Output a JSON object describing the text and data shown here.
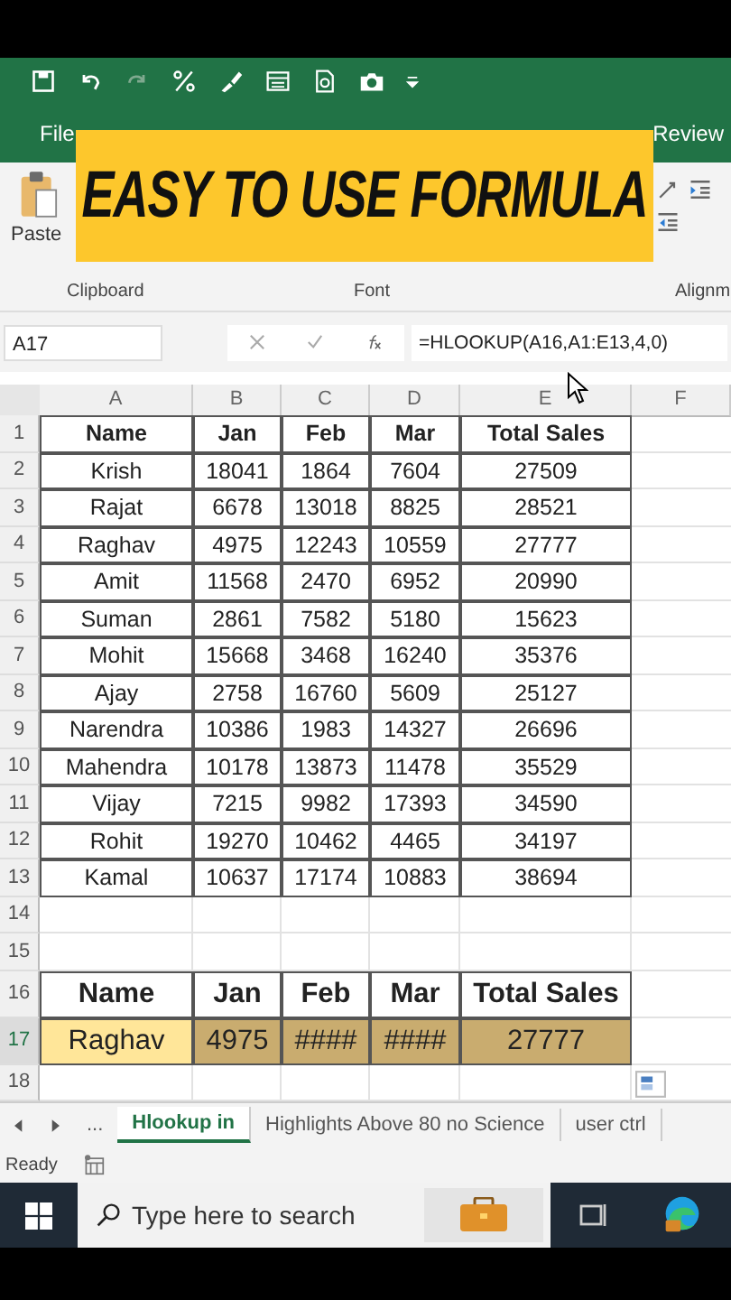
{
  "ribbon": {
    "tabs": [
      {
        "label": "File",
        "selected": false
      },
      {
        "label": "Review",
        "selected": false
      }
    ],
    "paste_label": "Paste",
    "groups": [
      "Clipboard",
      "Font",
      "Alignm"
    ]
  },
  "banner": {
    "text": "EASY TO USE FORMULA"
  },
  "formula_bar": {
    "name_box": "A17",
    "formula": "=HLOOKUP(A16,A1:E13,4,0)"
  },
  "sheet": {
    "column_headers": [
      "A",
      "B",
      "C",
      "D",
      "E",
      "F"
    ],
    "rows": [
      {
        "number": "1",
        "kind": "header",
        "cells": [
          "Name",
          "Jan",
          "Feb",
          "Mar",
          "Total Sales"
        ]
      },
      {
        "number": "2",
        "kind": "data",
        "cells": [
          "Krish",
          "18041",
          "1864",
          "7604",
          "27509"
        ]
      },
      {
        "number": "3",
        "kind": "data",
        "cells": [
          "Rajat",
          "6678",
          "13018",
          "8825",
          "28521"
        ]
      },
      {
        "number": "4",
        "kind": "data",
        "cells": [
          "Raghav",
          "4975",
          "12243",
          "10559",
          "27777"
        ]
      },
      {
        "number": "5",
        "kind": "data",
        "cells": [
          "Amit",
          "11568",
          "2470",
          "6952",
          "20990"
        ]
      },
      {
        "number": "6",
        "kind": "data",
        "cells": [
          "Suman",
          "2861",
          "7582",
          "5180",
          "15623"
        ]
      },
      {
        "number": "7",
        "kind": "data",
        "cells": [
          "Mohit",
          "15668",
          "3468",
          "16240",
          "35376"
        ]
      },
      {
        "number": "8",
        "kind": "data",
        "cells": [
          "Ajay",
          "2758",
          "16760",
          "5609",
          "25127"
        ]
      },
      {
        "number": "9",
        "kind": "data",
        "cells": [
          "Narendra",
          "10386",
          "1983",
          "14327",
          "26696"
        ]
      },
      {
        "number": "10",
        "kind": "data",
        "cells": [
          "Mahendra",
          "10178",
          "13873",
          "11478",
          "35529"
        ]
      },
      {
        "number": "11",
        "kind": "data",
        "cells": [
          "Vijay",
          "7215",
          "9982",
          "17393",
          "34590"
        ]
      },
      {
        "number": "12",
        "kind": "data",
        "cells": [
          "Rohit",
          "19270",
          "10462",
          "4465",
          "34197"
        ]
      },
      {
        "number": "13",
        "kind": "data",
        "cells": [
          "Kamal",
          "10637",
          "17174",
          "10883",
          "38694"
        ]
      },
      {
        "number": "14",
        "kind": "blank"
      },
      {
        "number": "15",
        "kind": "blank"
      },
      {
        "number": "16",
        "kind": "result_header",
        "cells": [
          "Name",
          "Jan",
          "Feb",
          "Mar",
          "Total Sales"
        ]
      },
      {
        "number": "17",
        "kind": "result",
        "cells": [
          {
            "text": "Raghav",
            "active": true
          },
          {
            "text": "4975",
            "active": false
          },
          {
            "text": "####",
            "active": false
          },
          {
            "text": "####",
            "active": false
          },
          {
            "text": "27777",
            "active": false
          }
        ]
      },
      {
        "number": "18",
        "kind": "blank"
      }
    ]
  },
  "sheet_tabs": {
    "overflow": "...",
    "tabs": [
      {
        "label": "Hlookup in",
        "selected": true
      },
      {
        "label": "Highlights Above 80 no Science",
        "selected": false
      },
      {
        "label": "user ctrl",
        "selected": false
      }
    ]
  },
  "status_bar": {
    "text": "Ready"
  },
  "taskbar": {
    "search_placeholder": "Type here to search"
  }
}
